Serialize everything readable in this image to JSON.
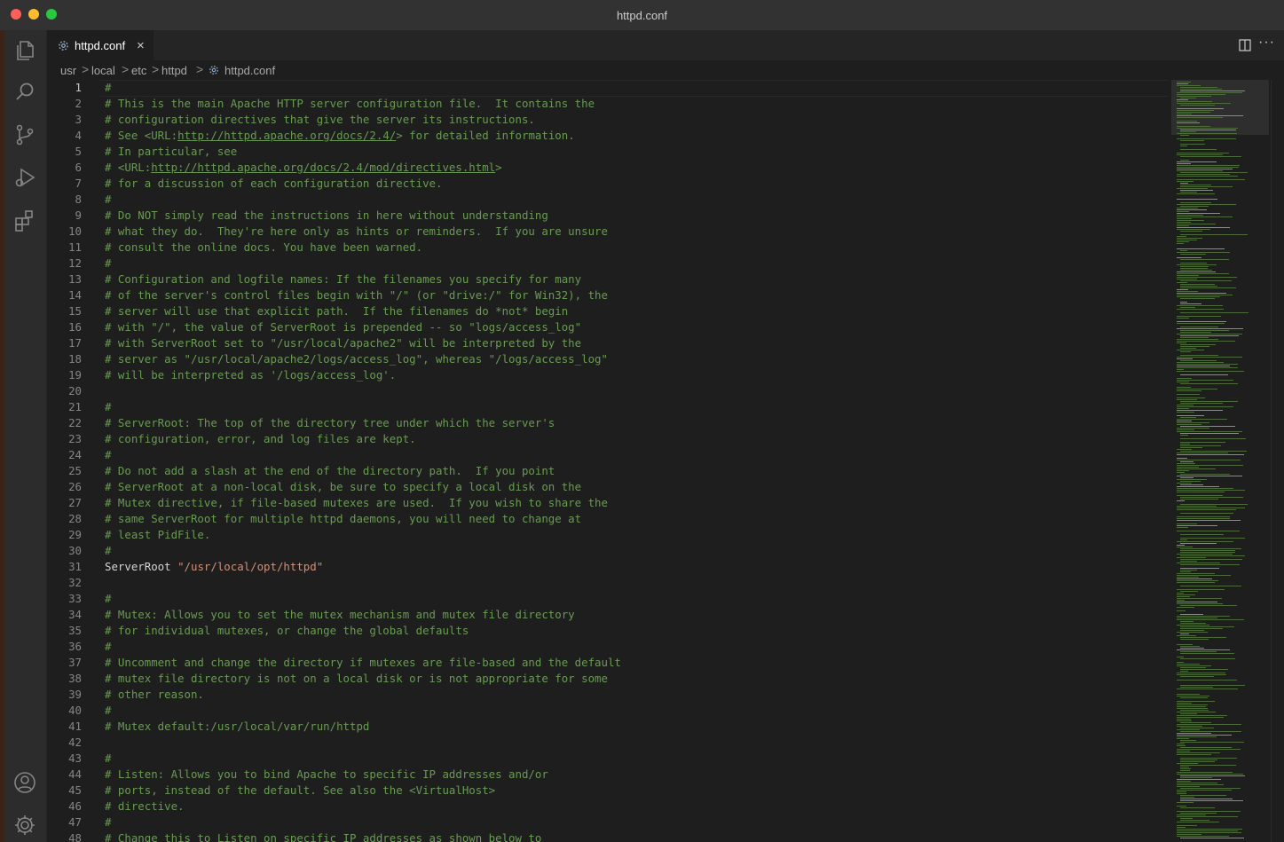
{
  "window": {
    "title": "httpd.conf"
  },
  "activity_bar": {
    "icons": [
      "files-icon",
      "search-icon",
      "source-control-icon",
      "run-debug-icon",
      "extensions-icon",
      "account-icon",
      "settings-gear-icon"
    ]
  },
  "tab": {
    "label": "httpd.conf",
    "close": "×"
  },
  "breadcrumb": [
    "usr",
    "local",
    "etc",
    "httpd",
    "httpd.conf"
  ],
  "breadcrumb_separator": ">",
  "editor": {
    "active_line": 1,
    "lines": [
      [
        {
          "t": "#",
          "c": "cm"
        }
      ],
      [
        {
          "t": "# This is the main Apache HTTP server configuration file.  It contains the",
          "c": "cm"
        }
      ],
      [
        {
          "t": "# configuration directives that give the server its instructions.",
          "c": "cm"
        }
      ],
      [
        {
          "t": "# See <URL:",
          "c": "cm"
        },
        {
          "t": "http://httpd.apache.org/docs/2.4/",
          "c": "link"
        },
        {
          "t": "> for detailed information.",
          "c": "cm"
        }
      ],
      [
        {
          "t": "# In particular, see",
          "c": "cm"
        }
      ],
      [
        {
          "t": "# <URL:",
          "c": "cm"
        },
        {
          "t": "http://httpd.apache.org/docs/2.4/mod/directives.html",
          "c": "link"
        },
        {
          "t": ">",
          "c": "cm"
        }
      ],
      [
        {
          "t": "# for a discussion of each configuration directive.",
          "c": "cm"
        }
      ],
      [
        {
          "t": "#",
          "c": "cm"
        }
      ],
      [
        {
          "t": "# Do NOT simply read the instructions in here without understanding",
          "c": "cm"
        }
      ],
      [
        {
          "t": "# what they do.  They're here only as hints or reminders.  If you are unsure",
          "c": "cm"
        }
      ],
      [
        {
          "t": "# consult the online docs. You have been warned.",
          "c": "cm"
        }
      ],
      [
        {
          "t": "#",
          "c": "cm"
        }
      ],
      [
        {
          "t": "# Configuration and logfile names: If the filenames you specify for many",
          "c": "cm"
        }
      ],
      [
        {
          "t": "# of the server's control files begin with \"/\" (or \"drive:/\" for Win32), the",
          "c": "cm"
        }
      ],
      [
        {
          "t": "# server will use that explicit path.  If the filenames do *not* begin",
          "c": "cm"
        }
      ],
      [
        {
          "t": "# with \"/\", the value of ServerRoot is prepended -- so \"logs/access_log\"",
          "c": "cm"
        }
      ],
      [
        {
          "t": "# with ServerRoot set to \"/usr/local/apache2\" will be interpreted by the",
          "c": "cm"
        }
      ],
      [
        {
          "t": "# server as \"/usr/local/apache2/logs/access_log\", whereas \"/logs/access_log\"",
          "c": "cm"
        }
      ],
      [
        {
          "t": "# will be interpreted as '/logs/access_log'.",
          "c": "cm"
        }
      ],
      [],
      [
        {
          "t": "#",
          "c": "cm"
        }
      ],
      [
        {
          "t": "# ServerRoot: The top of the directory tree under which the server's",
          "c": "cm"
        }
      ],
      [
        {
          "t": "# configuration, error, and log files are kept.",
          "c": "cm"
        }
      ],
      [
        {
          "t": "#",
          "c": "cm"
        }
      ],
      [
        {
          "t": "# Do not add a slash at the end of the directory path.  If you point",
          "c": "cm"
        }
      ],
      [
        {
          "t": "# ServerRoot at a non-local disk, be sure to specify a local disk on the",
          "c": "cm"
        }
      ],
      [
        {
          "t": "# Mutex directive, if file-based mutexes are used.  If you wish to share the",
          "c": "cm"
        }
      ],
      [
        {
          "t": "# same ServerRoot for multiple httpd daemons, you will need to change at",
          "c": "cm"
        }
      ],
      [
        {
          "t": "# least PidFile.",
          "c": "cm"
        }
      ],
      [
        {
          "t": "#",
          "c": "cm"
        }
      ],
      [
        {
          "t": "ServerRoot ",
          "c": "kw"
        },
        {
          "t": "\"/usr/local/opt/httpd\"",
          "c": "str"
        }
      ],
      [],
      [
        {
          "t": "#",
          "c": "cm"
        }
      ],
      [
        {
          "t": "# Mutex: Allows you to set the mutex mechanism and mutex file directory",
          "c": "cm"
        }
      ],
      [
        {
          "t": "# for individual mutexes, or change the global defaults",
          "c": "cm"
        }
      ],
      [
        {
          "t": "#",
          "c": "cm"
        }
      ],
      [
        {
          "t": "# Uncomment and change the directory if mutexes are file-based and the default",
          "c": "cm"
        }
      ],
      [
        {
          "t": "# mutex file directory is not on a local disk or is not appropriate for some",
          "c": "cm"
        }
      ],
      [
        {
          "t": "# other reason.",
          "c": "cm"
        }
      ],
      [
        {
          "t": "#",
          "c": "cm"
        }
      ],
      [
        {
          "t": "# Mutex default:/usr/local/var/run/httpd",
          "c": "cm"
        }
      ],
      [],
      [
        {
          "t": "#",
          "c": "cm"
        }
      ],
      [
        {
          "t": "# Listen: Allows you to bind Apache to specific IP addresses and/or",
          "c": "cm"
        }
      ],
      [
        {
          "t": "# ports, instead of the default. See also the <VirtualHost>",
          "c": "cm"
        }
      ],
      [
        {
          "t": "# directive.",
          "c": "cm"
        }
      ],
      [
        {
          "t": "#",
          "c": "cm"
        }
      ],
      [
        {
          "t": "# Change this to Listen on specific IP addresses as shown below to",
          "c": "cm"
        }
      ]
    ]
  },
  "colors": {
    "comment": "#6a9955",
    "string": "#ce9178",
    "keyword": "#d4d4d4",
    "editor_bg": "#1e1e1e",
    "line_number": "#858585"
  }
}
